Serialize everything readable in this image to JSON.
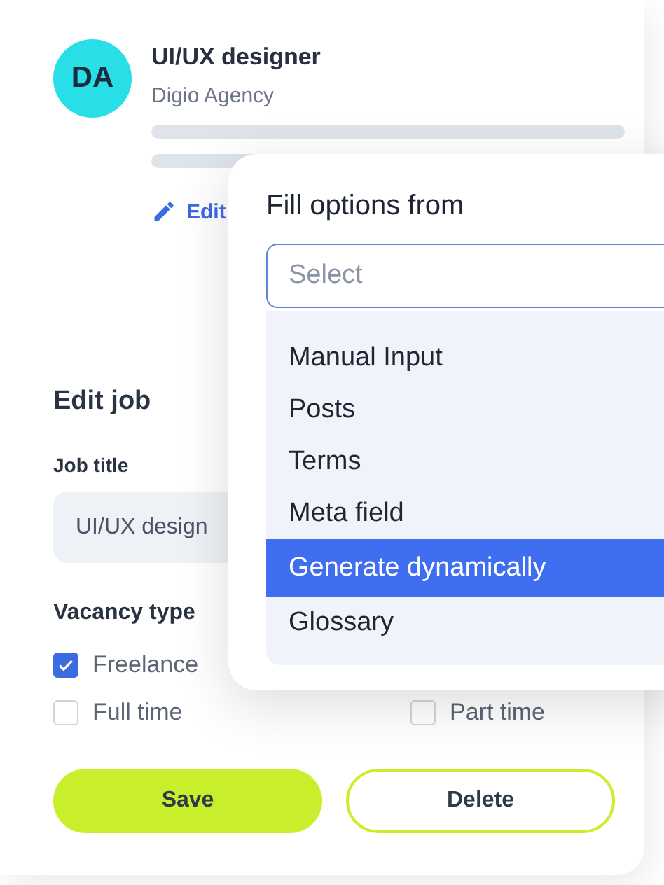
{
  "profile": {
    "initials": "DA",
    "title": "UI/UX designer",
    "company": "Digio Agency",
    "edit_link": "Edit"
  },
  "form": {
    "heading": "Edit job",
    "job_title_label": "Job title",
    "job_title_value": "UI/UX design",
    "vacancy_label": "Vacancy type",
    "options": [
      {
        "label": "Freelance",
        "checked": true
      },
      {
        "label": "Full time",
        "checked": false
      },
      {
        "label": "Part time",
        "checked": false
      }
    ],
    "buttons": [
      {
        "label": "Save",
        "kind": "primary"
      },
      {
        "label": "Delete",
        "kind": "outline"
      }
    ]
  },
  "popup": {
    "title": "Fill options from",
    "placeholder": "Select",
    "items": [
      {
        "label": "Manual Input",
        "selected": false
      },
      {
        "label": "Posts",
        "selected": false
      },
      {
        "label": "Terms",
        "selected": false
      },
      {
        "label": "Meta field",
        "selected": false
      },
      {
        "label": "Generate dynamically",
        "selected": true
      },
      {
        "label": "Glossary",
        "selected": false
      }
    ]
  }
}
